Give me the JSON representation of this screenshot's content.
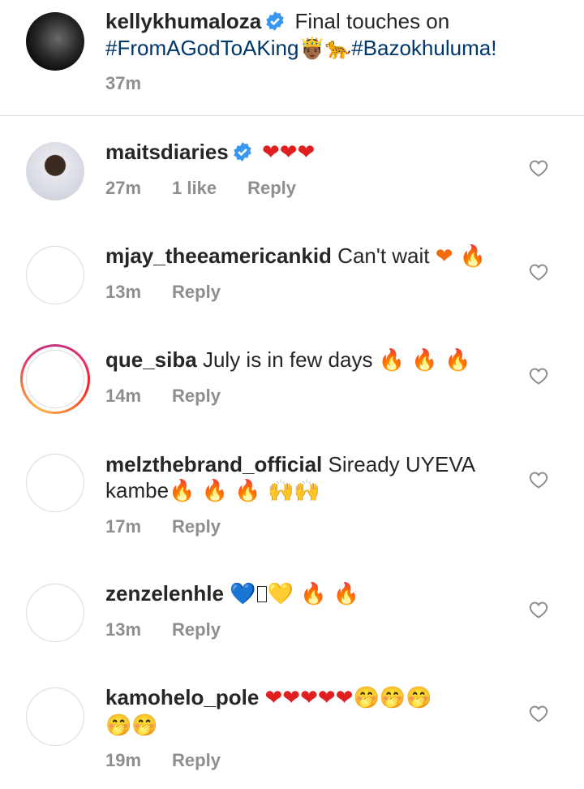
{
  "caption": {
    "username": "kellykhumaloza",
    "text_before": "Final touches on",
    "hashtag1": "#FromAGodToAKing",
    "emoji": "🤴🏾🐆",
    "hashtag2": "#Bazokhuluma!",
    "time": "37m"
  },
  "comments": [
    {
      "username": "maitsdiaries",
      "text": "❤❤❤",
      "time": "27m",
      "likes": "1 like",
      "reply": "Reply"
    },
    {
      "username": "mjay_theeamericankid",
      "text": "Can't wait",
      "emoji": "❤ 🔥",
      "time": "13m",
      "reply": "Reply"
    },
    {
      "username": "que_siba",
      "text": "July is in few days",
      "emoji": "🔥 🔥 🔥",
      "time": "14m",
      "reply": "Reply"
    },
    {
      "username": "melzthebrand_official",
      "text": "Siready UYEVA",
      "text_line2": "kambe",
      "emoji": "🔥 🔥 🔥 🙌🙌",
      "time": "17m",
      "reply": "Reply"
    },
    {
      "username": "zenzelenhle",
      "emoji_a": "💙",
      "emoji_b": "💛 🔥 🔥",
      "time": "13m",
      "reply": "Reply"
    },
    {
      "username": "kamohelo_pole",
      "emoji": "❤❤❤❤❤",
      "emoji_face": "🤭🤭🤭",
      "emoji_line2": "🤭🤭",
      "time": "19m",
      "reply": "Reply"
    }
  ],
  "icons": {
    "verified": "verified-badge-icon",
    "like": "heart-outline-icon"
  },
  "colors": {
    "verified": "#3897f0",
    "hashtag": "#00376b",
    "meta": "#8e8e8e"
  }
}
